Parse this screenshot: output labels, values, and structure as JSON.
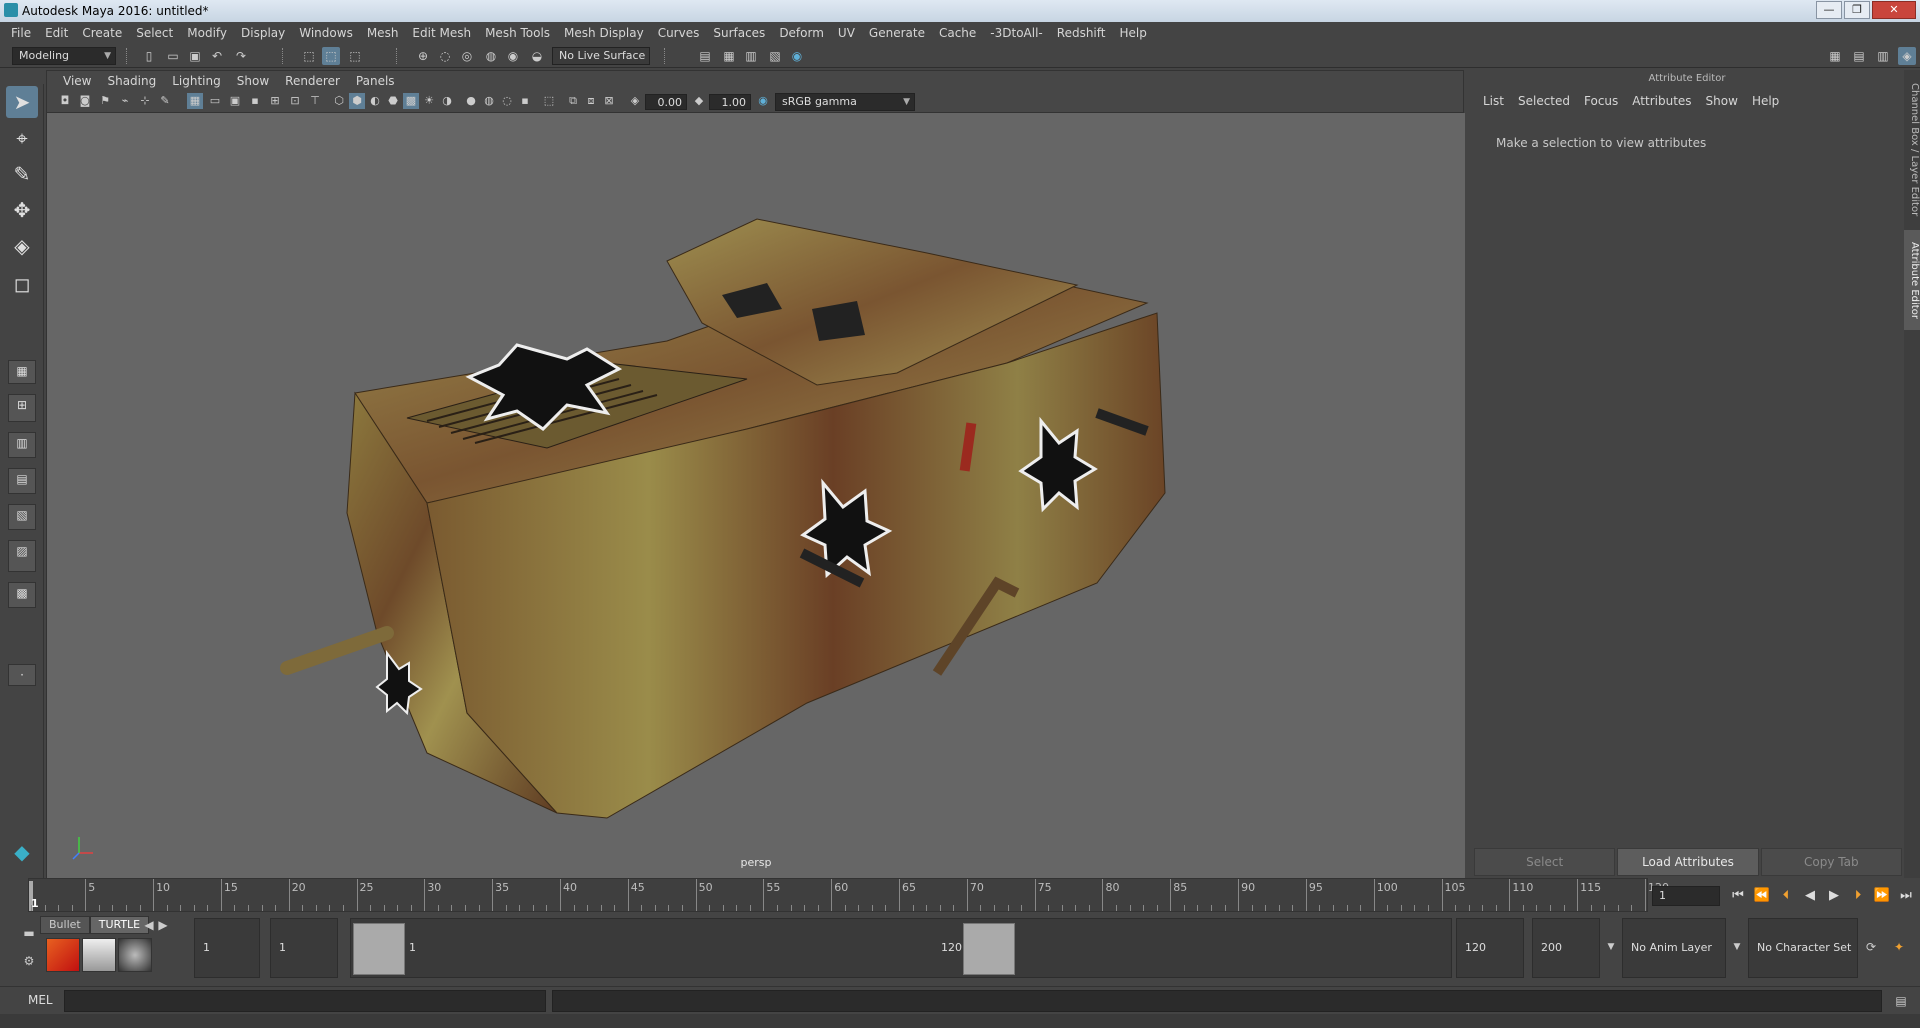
{
  "window": {
    "title": "Autodesk Maya 2016: untitled*",
    "controls": [
      "—",
      "❐",
      "✕"
    ]
  },
  "menubar": [
    "File",
    "Edit",
    "Create",
    "Select",
    "Modify",
    "Display",
    "Windows",
    "Mesh",
    "Edit Mesh",
    "Mesh Tools",
    "Mesh Display",
    "Curves",
    "Surfaces",
    "Deform",
    "UV",
    "Generate",
    "Cache",
    "-3DtoAll-",
    "Redshift",
    "Help"
  ],
  "shelf": {
    "menu_set": "Modeling",
    "live_surface": "No Live Surface"
  },
  "viewport": {
    "menus": [
      "View",
      "Shading",
      "Lighting",
      "Show",
      "Renderer",
      "Panels"
    ],
    "exposure": "0.00",
    "gamma": "1.00",
    "color_space": "sRGB gamma",
    "camera_label": "persp"
  },
  "attribute_editor": {
    "header": "Attribute Editor",
    "menus": [
      "List",
      "Selected",
      "Focus",
      "Attributes",
      "Show",
      "Help"
    ],
    "message": "Make a selection to view attributes",
    "buttons": [
      "Select",
      "Load Attributes",
      "Copy Tab"
    ]
  },
  "side_tabs": [
    "Channel Box / Layer Editor",
    "Attribute Editor"
  ],
  "timeline": {
    "ticks": [
      "5",
      "10",
      "15",
      "20",
      "25",
      "30",
      "35",
      "40",
      "45",
      "50",
      "55",
      "60",
      "65",
      "70",
      "75",
      "80",
      "85",
      "90",
      "95",
      "100",
      "105",
      "110",
      "115",
      "120"
    ],
    "min": 1,
    "max": 120,
    "current_frame_label": "1",
    "current_frame_field": "1"
  },
  "range": {
    "shelf_tabs": [
      "Bullet",
      "TURTLE"
    ],
    "start_time": "1",
    "playback_start": "1",
    "range_start_label": "1",
    "range_end_label": "120",
    "playback_end": "120",
    "end_time": "200",
    "anim_layer": "No Anim Layer",
    "character_set": "No Character Set"
  },
  "command": {
    "label": "MEL"
  },
  "colors": {
    "accent": "#5f7f96",
    "viewport_bg": "#666666",
    "panel_bg": "#444444"
  }
}
